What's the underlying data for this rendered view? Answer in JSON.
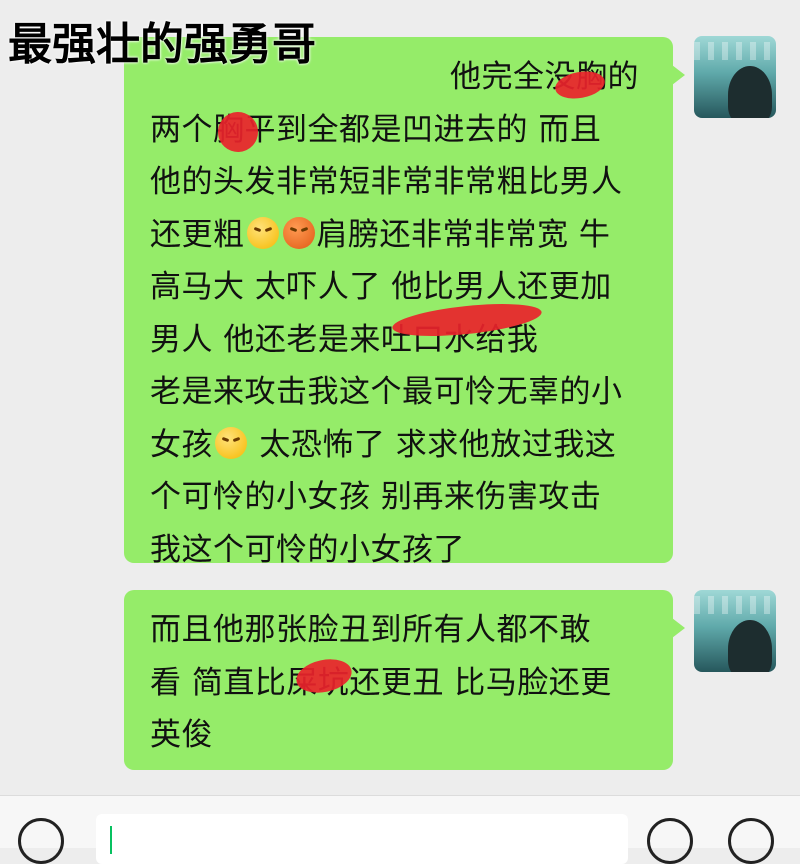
{
  "overlay_title": "最强壮的强勇哥",
  "messages": [
    {
      "sender": "self",
      "lines": [
        {
          "a": "他完全没胸的"
        },
        {
          "a": "两个胸平到全都是凹进去的 而且"
        },
        {
          "a": "他的头发非常短非常非常粗比男人"
        },
        {
          "a": "还更粗",
          "b": "肩膀还非常非常宽 牛"
        },
        {
          "a": "高马大 太吓人了 他比男人还更加"
        },
        {
          "a": "男人 他还老是来吐口水给我"
        },
        {
          "a": "老是来攻击我这个最可怜无辜的小"
        },
        {
          "a": "女孩",
          "b": "太恐怖了 求求他放过我这"
        },
        {
          "a": "个可怜的小女孩 别再来伤害攻击"
        },
        {
          "a": "我这个可怜的小女孩了"
        }
      ]
    },
    {
      "sender": "self",
      "lines": [
        {
          "a": "而且他那张脸丑到所有人都不敢"
        },
        {
          "a": "看 简直比屎坑还更丑 比马脸还更"
        },
        {
          "a": "英俊"
        }
      ]
    }
  ],
  "emojis": [
    "crying-emoji",
    "angry-emoji"
  ],
  "colors": {
    "bubble": "#95ec69",
    "background": "#ededed",
    "redaction": "#e9232b"
  },
  "input": {
    "value": ""
  }
}
